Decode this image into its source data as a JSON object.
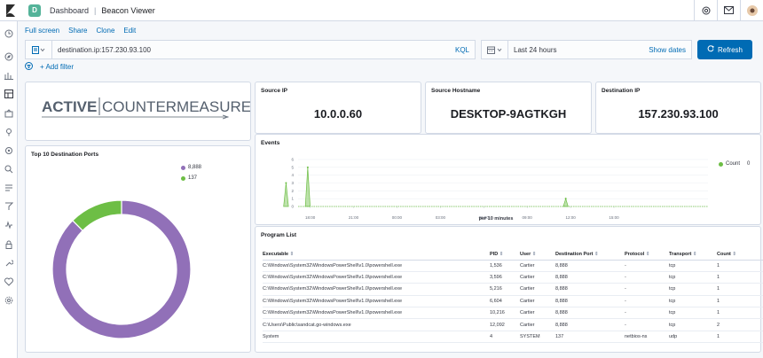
{
  "header": {
    "space_initial": "D",
    "breadcrumbs": [
      "Dashboard",
      "Beacon Viewer"
    ]
  },
  "links": [
    "Full screen",
    "Share",
    "Clone",
    "Edit"
  ],
  "query": {
    "text": "destination.ip:157.230.93.100",
    "language": "KQL"
  },
  "time": {
    "label": "Last 24 hours",
    "show_dates": "Show dates",
    "refresh_label": "Refresh"
  },
  "filter": {
    "add_label": "+ Add filter"
  },
  "logo": {
    "text_left": "ACTIVE",
    "text_right": "COUNTERMEASURES"
  },
  "metrics": {
    "source_ip": {
      "title": "Source IP",
      "value": "10.0.0.60"
    },
    "source_hostname": {
      "title": "Source Hostname",
      "value": "DESKTOP-9AGTKGH"
    },
    "destination_ip": {
      "title": "Destination IP",
      "value": "157.230.93.100"
    }
  },
  "ports": {
    "title": "Top 10 Destination Ports",
    "legend": [
      {
        "label": "8,888",
        "color": "#9170b8"
      },
      {
        "label": "137",
        "color": "#6dbe45"
      }
    ]
  },
  "events": {
    "title": "Events",
    "xlabel": "per 10 minutes",
    "legend_label": "Count",
    "legend_value": "0",
    "color": "#6dbe45"
  },
  "program_list": {
    "title": "Program List",
    "columns": [
      "Executable",
      "PID",
      "User",
      "Destination Port",
      "Protocol",
      "Transport",
      "Count"
    ],
    "rows": [
      [
        "C:\\Windows\\System32\\WindowsPowerShell\\v1.0\\powershell.exe",
        "1,536",
        "Cartier",
        "8,888",
        "-",
        "tcp",
        "1"
      ],
      [
        "C:\\Windows\\System32\\WindowsPowerShell\\v1.0\\powershell.exe",
        "3,596",
        "Cartier",
        "8,888",
        "-",
        "tcp",
        "1"
      ],
      [
        "C:\\Windows\\System32\\WindowsPowerShell\\v1.0\\powershell.exe",
        "5,216",
        "Cartier",
        "8,888",
        "-",
        "tcp",
        "1"
      ],
      [
        "C:\\Windows\\System32\\WindowsPowerShell\\v1.0\\powershell.exe",
        "6,604",
        "Cartier",
        "8,888",
        "-",
        "tcp",
        "1"
      ],
      [
        "C:\\Windows\\System32\\WindowsPowerShell\\v1.0\\powershell.exe",
        "10,216",
        "Cartier",
        "8,888",
        "-",
        "tcp",
        "1"
      ],
      [
        "C:\\Users\\Public\\sandcat.go-windows.exe",
        "12,092",
        "Cartier",
        "8,888",
        "-",
        "tcp",
        "2"
      ],
      [
        "System",
        "4",
        "SYSTEM",
        "137",
        "netbios-ns",
        "udp",
        "1"
      ]
    ]
  },
  "chart_data": [
    {
      "type": "pie",
      "title": "Top 10 Destination Ports",
      "categories": [
        "8,888",
        "137"
      ],
      "values": [
        7,
        1
      ]
    },
    {
      "type": "area",
      "title": "Events",
      "xlabel": "per 10 minutes",
      "ylabel": "",
      "x_ticks": [
        "18:00",
        "21:00",
        "00:00",
        "03:00",
        "06:00",
        "09:00",
        "12:00",
        "15:00"
      ],
      "y_ticks": [
        "0",
        "1",
        "2",
        "3",
        "4",
        "5",
        "6"
      ],
      "ylim": [
        0,
        6
      ],
      "series": [
        {
          "name": "Count",
          "x": [
            "16:10",
            "16:20",
            "16:30",
            "16:40",
            "17:40",
            "17:50",
            "18:00",
            "11:30",
            "11:40",
            "11:50"
          ],
          "values": [
            0,
            3,
            0,
            0,
            0,
            5,
            0,
            0,
            1,
            0
          ]
        }
      ]
    }
  ]
}
